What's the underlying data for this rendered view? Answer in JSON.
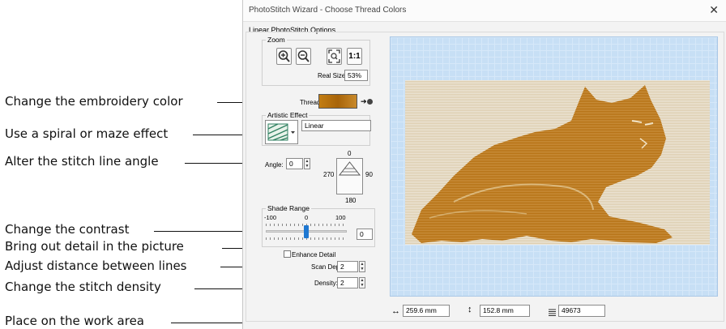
{
  "callouts": {
    "embroidery_color": "Change the embroidery color",
    "spiral_maze": "Use a spiral or maze effect",
    "stitch_angle": "Alter the stitch line angle",
    "contrast": "Change the contrast",
    "detail": "Bring out detail in the picture",
    "distance": "Adjust distance between lines",
    "density": "Change the stitch density",
    "work_area": "Place on the work area"
  },
  "dialog": {
    "title": "PhotoStitch Wizard - Choose Thread Colors",
    "close_glyph": "✕",
    "options_group": "Linear PhotoStitch Options",
    "zoom": {
      "label": "Zoom",
      "one_to_one": "1:1",
      "real_size_label": "Real Size",
      "real_size_value": "53%"
    },
    "thread_color_label": "Thread Color:",
    "thread_color": "#b86e0b",
    "artistic_effect": {
      "label": "Artistic Effect",
      "value": "Linear"
    },
    "angle": {
      "label": "Angle:",
      "value": "0",
      "dial_top": "0",
      "dial_left": "270",
      "dial_right": "90",
      "dial_bottom": "180"
    },
    "shade_range": {
      "label": "Shade Range",
      "min": "-100",
      "mid": "0",
      "max": "100",
      "value": "0",
      "level": 0.5
    },
    "enhance_detail": {
      "label": "Enhance Detail",
      "checked": false
    },
    "scan_depth": {
      "label": "Scan Depth:",
      "value": "2"
    },
    "density": {
      "label": "Density:",
      "value": "2"
    },
    "status": {
      "width_icon": "↔",
      "width": "259.6 mm",
      "height_icon": "↕",
      "height": "152.8 mm",
      "stitches_icon": "stitch-count-icon",
      "stitches": "49673"
    }
  },
  "colors": {
    "stitch": "#b46f10",
    "preview_bg": "#c7dff5"
  }
}
